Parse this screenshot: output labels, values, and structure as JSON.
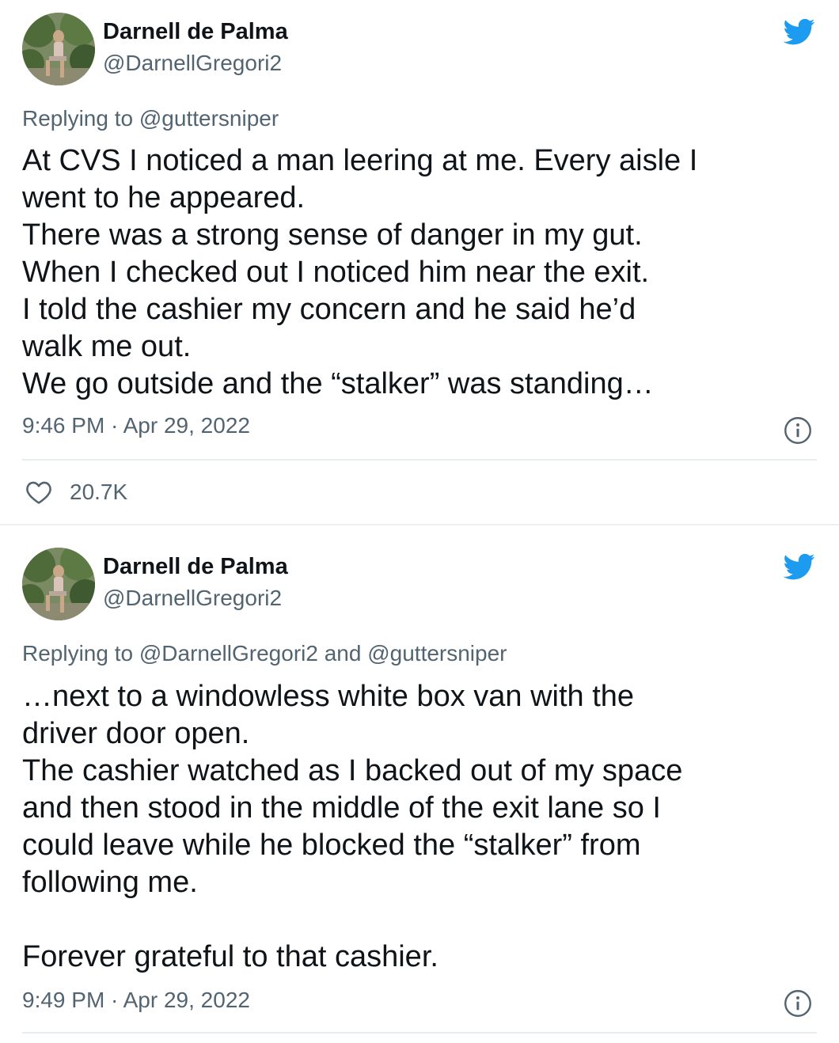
{
  "colors": {
    "text": "#0f1419",
    "secondary": "#536471",
    "twitter_blue": "#1d9bf0",
    "divider": "#e6ecf0"
  },
  "icons": {
    "brand": "twitter-bird-icon",
    "info": "info-icon",
    "like": "heart-icon"
  },
  "tweets": [
    {
      "display_name": "Darnell de Palma",
      "handle": "@DarnellGregori2",
      "reply_prefix": "Replying to ",
      "reply_mentions": "@guttersniper",
      "lines": [
        "At CVS I noticed a man leering at me. Every aisle I",
        "went to he appeared.",
        "There was a strong sense of danger in my gut.",
        "When I checked out I noticed him near the exit.",
        "I told the cashier my concern and he said he’d",
        "walk me out.",
        "We go outside and the “stalker” was standing…"
      ],
      "timestamp": "9:46 PM · Apr 29, 2022",
      "likes": "20.7K"
    },
    {
      "display_name": "Darnell de Palma",
      "handle": "@DarnellGregori2",
      "reply_prefix": "Replying to ",
      "reply_mentions": "@DarnellGregori2 and @guttersniper",
      "lines": [
        "…next to a windowless white box van with the",
        "driver door open.",
        "The cashier watched as I backed out of my space",
        "and then stood in the middle of the exit lane so I",
        "could leave while he blocked the “stalker” from",
        "following me.",
        "",
        "Forever grateful to that cashier."
      ],
      "timestamp": "9:49 PM · Apr 29, 2022"
    }
  ]
}
